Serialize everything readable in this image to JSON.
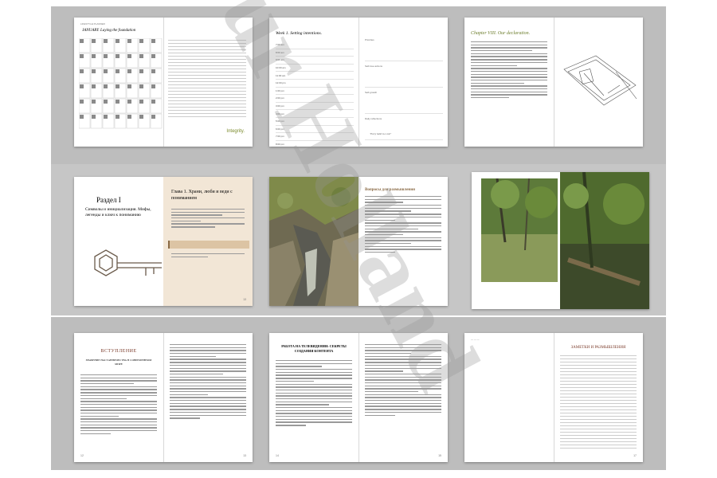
{
  "watermark": "ur Holland",
  "row1": {
    "calendar": {
      "title": "JANUARY. Laying the foundation",
      "brand": "Integrity."
    },
    "schedule": {
      "title": "Week 1. Setting intentions.",
      "times": [
        "7:00 am",
        "8:00 am",
        "9:00 am",
        "10:00 am",
        "11:00 am",
        "12:00 pm",
        "1:00 pm",
        "2:00 pm",
        "3:00 pm",
        "4:00 pm",
        "5:00 pm",
        "6:00 pm",
        "7:00 pm",
        "8:00 pm",
        "9:00 pm"
      ],
      "sections": [
        "Priorities",
        "Self-love actions",
        "Self-growth",
        "Daily reflections"
      ],
      "quote": "\"Every habit is a vote\""
    },
    "chapter": {
      "title": "Chapter VIII. Our declaration.",
      "illustration_label": "Sketch of a book with a pen"
    }
  },
  "row2": {
    "intro": {
      "part_title": "Раздел I",
      "part_subtitle": "Символы и инициализация. Мифы, легенды и ключ к пониманию",
      "chapter_title": "Глава 1. Храни, люби и веди с пониманием",
      "page_num": "13"
    },
    "photo_left": {
      "caption": "Rocky mossy creek"
    },
    "questions": {
      "title": "Вопросы для размышления"
    },
    "photos": {
      "left": "Forest trail",
      "right": "Fallen logs in woods"
    }
  },
  "row3": {
    "intro2": {
      "left_title": "ВСТУПЛЕНИЕ",
      "left_subtitle": "ЗНАЧЕНИЕ НАСТАВНИЧЕСТВА В СОВРЕМЕННОМ МИРЕ",
      "page_l": "12",
      "page_r": "13"
    },
    "chapter2": {
      "left_title": "РАБОТА НА ТЕЛЕВИДЕНИИ: СЕКРЕТЫ СОЗДАНИЯ КОНТЕНТА",
      "page_l": "14",
      "page_r": "15"
    },
    "notes": {
      "title": "ЗАМЕТКИ И РАЗМЫШЛЕНИЯ",
      "page_l": "16",
      "page_r": "17"
    }
  }
}
